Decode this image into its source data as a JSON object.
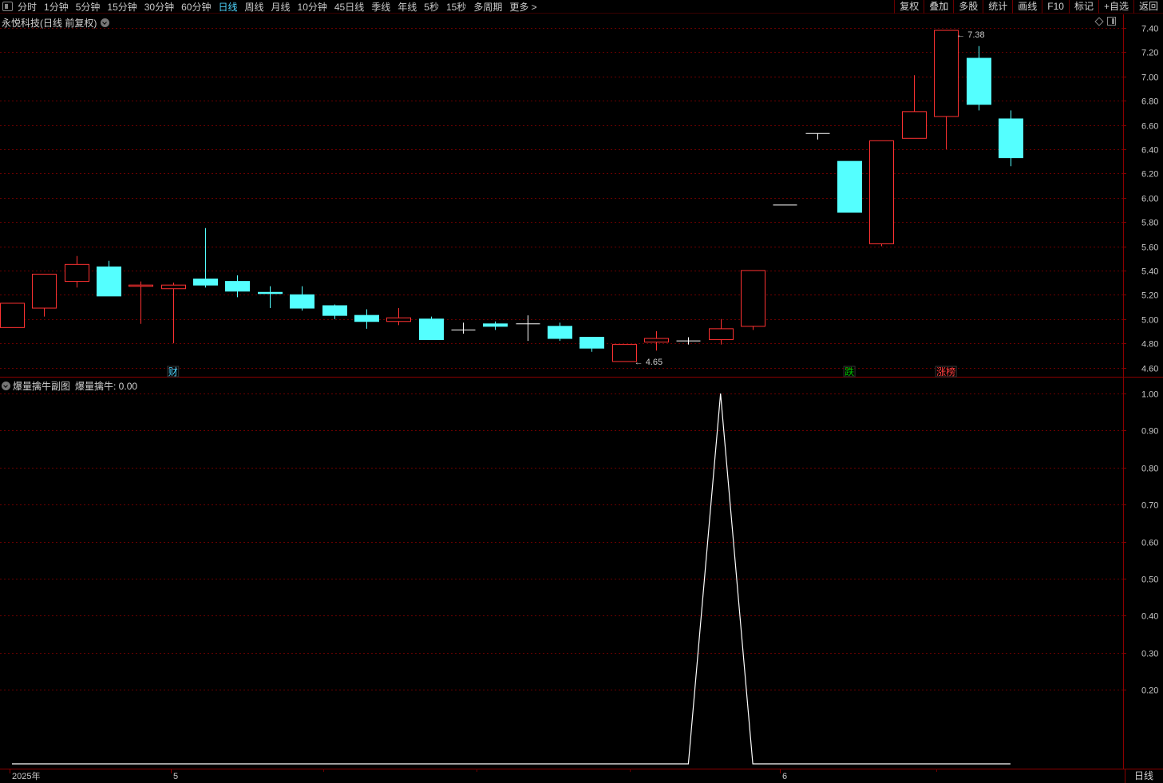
{
  "toolbar": {
    "periods": [
      "分时",
      "1分钟",
      "5分钟",
      "15分钟",
      "30分钟",
      "60分钟",
      "日线",
      "周线",
      "月线",
      "10分钟",
      "45日线",
      "季线",
      "年线",
      "5秒",
      "15秒",
      "多周期",
      "更多 >"
    ],
    "active_period": "日线",
    "buttons": [
      "复权",
      "叠加",
      "多股",
      "统计",
      "画线",
      "F10",
      "标记",
      "+自选",
      "返回"
    ]
  },
  "main_chart": {
    "title": "永悦科技(日线 前复权)",
    "y_ticks": [
      "7.40",
      "7.20",
      "7.00",
      "6.80",
      "6.60",
      "6.40",
      "6.20",
      "6.00",
      "5.80",
      "5.60",
      "5.40",
      "5.20",
      "5.00",
      "4.80",
      "4.60"
    ],
    "max_label": "7.38",
    "min_label": "4.65",
    "markers": [
      {
        "text": "财",
        "color": "#4fd6ff",
        "candle": 5
      },
      {
        "text": "跌",
        "color": "#00c000",
        "candle": 26
      },
      {
        "text": "涨榜",
        "color": "#ff4040",
        "candle": 29
      }
    ],
    "colors": {
      "up": "#ff3232",
      "down": "#54ffff",
      "flat": "#ffffff",
      "grid": "#6b0000"
    }
  },
  "sub_chart": {
    "title": "爆量擒牛副图",
    "value_label": "爆量擒牛: 0.00",
    "y_ticks": [
      "1.00",
      "0.90",
      "0.80",
      "0.70",
      "0.60",
      "0.50",
      "0.40",
      "0.30",
      "0.20"
    ]
  },
  "x_axis": {
    "labels": [
      "2025年",
      "5",
      "6"
    ]
  },
  "period_label": "日线",
  "chart_data": {
    "type": "candlestick",
    "ylim": [
      4.55,
      7.45
    ],
    "candles": [
      {
        "o": 4.93,
        "c": 5.13,
        "h": 5.13,
        "l": 4.93
      },
      {
        "o": 5.09,
        "c": 5.37,
        "h": 5.37,
        "l": 5.02
      },
      {
        "o": 5.31,
        "c": 5.45,
        "h": 5.52,
        "l": 5.26
      },
      {
        "o": 5.43,
        "c": 5.19,
        "h": 5.48,
        "l": 5.19
      },
      {
        "o": 5.27,
        "c": 5.28,
        "h": 5.31,
        "l": 4.96
      },
      {
        "o": 5.25,
        "c": 5.28,
        "h": 5.3,
        "l": 4.8
      },
      {
        "o": 5.33,
        "c": 5.28,
        "h": 5.75,
        "l": 5.26
      },
      {
        "o": 5.31,
        "c": 5.23,
        "h": 5.36,
        "l": 5.18
      },
      {
        "o": 5.22,
        "c": 5.21,
        "h": 5.27,
        "l": 5.09
      },
      {
        "o": 5.2,
        "c": 5.09,
        "h": 5.27,
        "l": 5.07
      },
      {
        "o": 5.11,
        "c": 5.03,
        "h": 5.12,
        "l": 5.0
      },
      {
        "o": 5.03,
        "c": 4.98,
        "h": 5.08,
        "l": 4.92
      },
      {
        "o": 4.98,
        "c": 5.01,
        "h": 5.09,
        "l": 4.95
      },
      {
        "o": 5.0,
        "c": 4.83,
        "h": 5.02,
        "l": 4.83
      },
      {
        "o": 4.91,
        "c": 4.91,
        "h": 4.97,
        "l": 4.88
      },
      {
        "o": 4.96,
        "c": 4.94,
        "h": 4.98,
        "l": 4.91
      },
      {
        "o": 4.96,
        "c": 4.96,
        "h": 5.03,
        "l": 4.82
      },
      {
        "o": 4.94,
        "c": 4.84,
        "h": 4.97,
        "l": 4.82
      },
      {
        "o": 4.85,
        "c": 4.76,
        "h": 4.85,
        "l": 4.73
      },
      {
        "o": 4.65,
        "c": 4.79,
        "h": 4.79,
        "l": 4.65
      },
      {
        "o": 4.81,
        "c": 4.84,
        "h": 4.9,
        "l": 4.74
      },
      {
        "o": 4.82,
        "c": 4.82,
        "h": 4.85,
        "l": 4.79
      },
      {
        "o": 4.83,
        "c": 4.92,
        "h": 5.0,
        "l": 4.79
      },
      {
        "o": 4.94,
        "c": 5.4,
        "h": 5.4,
        "l": 4.91
      },
      {
        "o": 5.94,
        "c": 5.94,
        "h": 5.94,
        "l": 5.94
      },
      {
        "o": 6.53,
        "c": 6.53,
        "h": 6.53,
        "l": 6.48
      },
      {
        "o": 6.3,
        "c": 5.88,
        "h": 6.3,
        "l": 5.88
      },
      {
        "o": 5.62,
        "c": 6.47,
        "h": 6.47,
        "l": 5.6
      },
      {
        "o": 6.49,
        "c": 6.71,
        "h": 7.01,
        "l": 6.49
      },
      {
        "o": 6.67,
        "c": 7.38,
        "h": 7.38,
        "l": 6.4
      },
      {
        "o": 7.15,
        "c": 6.77,
        "h": 7.25,
        "l": 6.72
      },
      {
        "o": 6.65,
        "c": 6.33,
        "h": 6.72,
        "l": 6.26
      }
    ],
    "indicator": {
      "name": "爆量擒牛",
      "ylim": [
        0,
        1.0
      ],
      "values": [
        0,
        0,
        0,
        0,
        0,
        0,
        0,
        0,
        0,
        0,
        0,
        0,
        0,
        0,
        0,
        0,
        0,
        0,
        0,
        0,
        0,
        0,
        1,
        0,
        0,
        0,
        0,
        0,
        0,
        0,
        0,
        0
      ]
    }
  }
}
